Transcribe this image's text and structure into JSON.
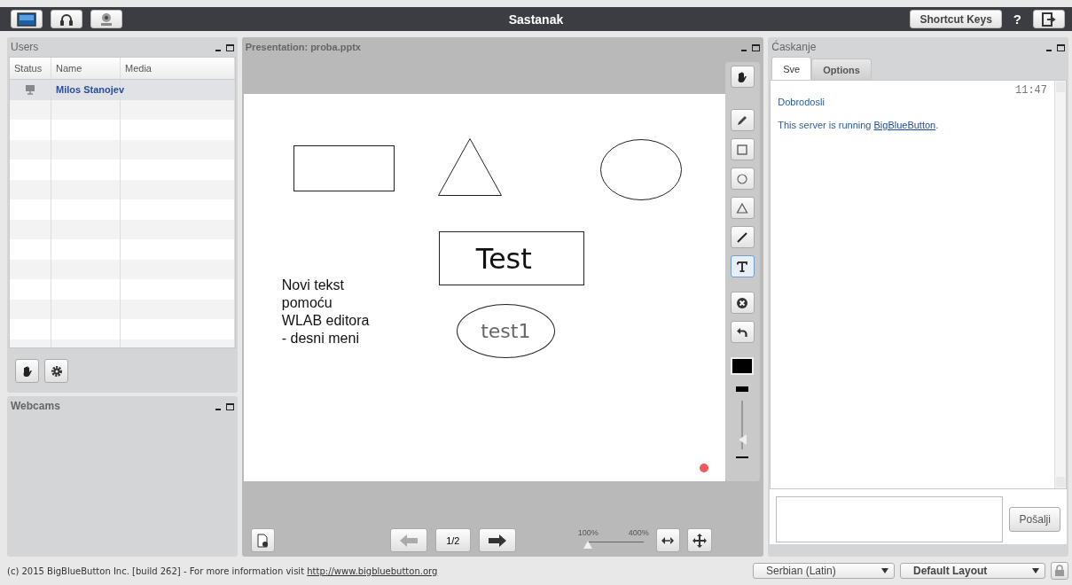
{
  "title": "Sastanak",
  "toolbar": {
    "left_buttons": [
      {
        "kind": "desktop"
      },
      {
        "kind": "headset"
      },
      {
        "kind": "webcam"
      }
    ],
    "shortcut_button": "Shortcut Keys",
    "help": "?"
  },
  "users_panel": {
    "title": "Users",
    "columns": [
      "Status",
      "Name",
      "Media"
    ],
    "rows": [
      {
        "name": "Milos Stanojev",
        "selected": true
      }
    ],
    "actions": [
      {
        "kind": "hand"
      },
      {
        "kind": "settings"
      }
    ]
  },
  "webcams_panel": {
    "title": "Webcams"
  },
  "presentation": {
    "title": "Presentation: proba.pptx",
    "annotations": [
      {
        "kind": "rectangle"
      },
      {
        "kind": "triangle"
      },
      {
        "kind": "ellipse"
      },
      {
        "kind": "boxed-text",
        "text": "Test"
      },
      {
        "kind": "text",
        "text": "Novi tekst\npomoću\nWLAB editora\n- desni meni"
      },
      {
        "kind": "ellipse-text",
        "text": "test1"
      }
    ],
    "tools": [
      {
        "kind": "hand",
        "selected": false
      },
      {
        "kind": "pencil",
        "selected": false
      },
      {
        "kind": "rectangle",
        "selected": false
      },
      {
        "kind": "ellipse",
        "selected": false
      },
      {
        "kind": "triangle",
        "selected": false
      },
      {
        "kind": "line",
        "selected": false
      },
      {
        "kind": "text",
        "selected": true
      },
      {
        "kind": "clear",
        "selected": false
      },
      {
        "kind": "undo",
        "selected": false
      }
    ],
    "thickness": {
      "level": 0.1
    },
    "pager": {
      "page": "1/2",
      "prev_disabled": true
    },
    "zoom": {
      "min_label": "100%",
      "max_label": "400%",
      "level": 0
    }
  },
  "chat": {
    "title": "Ćaskanje",
    "tabs": [
      {
        "label": "Sve",
        "selected": true
      },
      {
        "label": "Options",
        "selected": false
      }
    ],
    "time": "11:47",
    "messages": [
      {
        "text": "Dobrodosli"
      },
      {
        "text": "This server is running ",
        "link": "BigBlueButton",
        "after": "."
      }
    ],
    "send_button": "Pošalji"
  },
  "footer": {
    "text": "(c) 2015 BigBlueButton Inc. [build 262] - For more information visit ",
    "link": "http://www.bigbluebutton.org",
    "language": "Serbian (Latin)",
    "layout": "Default Layout"
  }
}
